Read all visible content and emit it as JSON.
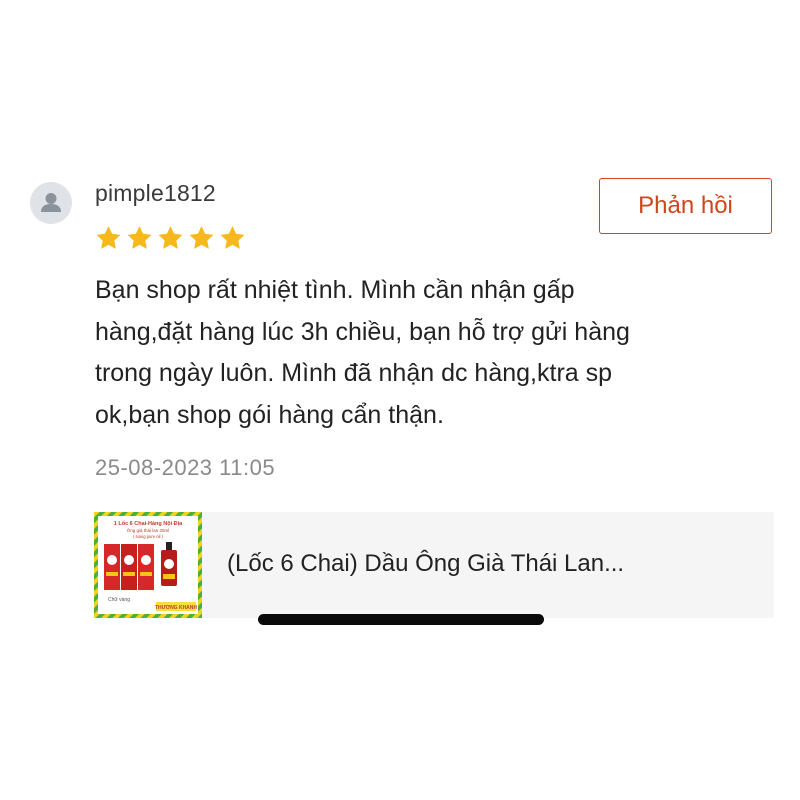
{
  "review": {
    "username": "pimple1812",
    "rating": 5,
    "reply_label": "Phản hồi",
    "text_lines": [
      "Bạn shop rất nhiệt tình. Mình cần nhận gấp",
      "hàng,đặt hàng lúc 3h chiều, bạn hỗ trợ gửi hàng",
      "trong ngày luôn. Mình đã nhận dc hàng,ktra sp",
      "ok,bạn shop gói hàng cẩn thận."
    ],
    "timestamp": "25-08-2023 11:05"
  },
  "product": {
    "title": "(Lốc 6 Chai) Dầu Ông Già Thái Lan...",
    "thumbnail_text": {
      "line1": "1 Lốc 6 Chai-Hàng Nội Địa",
      "line2": "Ông già thái lan 25ml",
      "line3": "( siang pure oil )",
      "line4": "Chữ vàng",
      "line5": "THƯƠNG KHANH"
    }
  },
  "colors": {
    "accent": "#d0451b",
    "star": "#f6b81a",
    "card_background": "#f5f5f5",
    "muted_text": "#8a8a8a"
  },
  "icons": {
    "avatar": "user-avatar-icon",
    "star": "star-icon"
  }
}
